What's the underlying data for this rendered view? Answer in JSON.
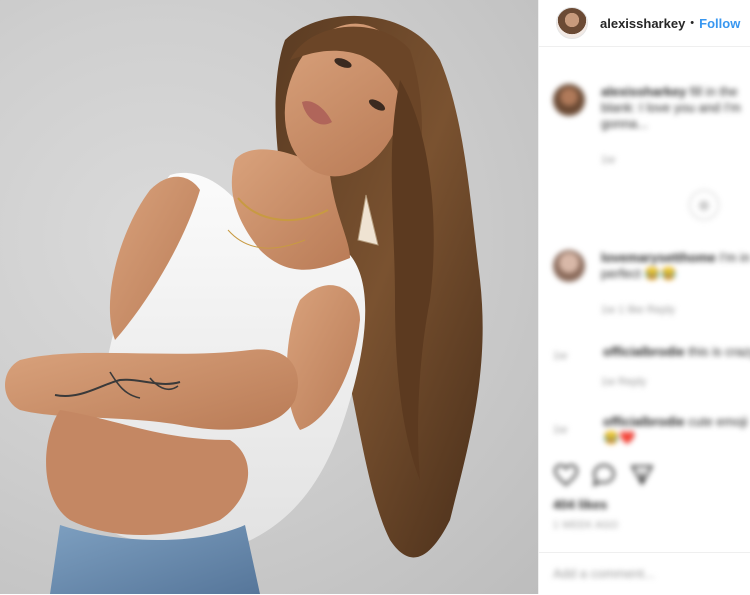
{
  "post": {
    "username": "alexissharkey",
    "separator": "•",
    "follow_label": "Follow"
  },
  "comments": [
    {
      "user": "alexissharkey",
      "text": "fill in the blank: I love you and I'm gonna...",
      "time": "1w"
    },
    {
      "user": "lovemarysetthome",
      "text": "I'm in perfect 😂😂",
      "meta": "1w  1 like  Reply"
    },
    {
      "user": "officialbrodie",
      "text": "this is crazy",
      "meta": "1w  Reply"
    },
    {
      "user": "officialbrodie",
      "text": "cute emoji 😂❤️",
      "meta": "1w"
    }
  ],
  "likes": "404 likes",
  "date": "1 WEEK AGO",
  "add_comment_placeholder": "Add a comment...",
  "icons": [
    "heart-icon",
    "comment-icon",
    "share-icon",
    "load-more-icon"
  ],
  "colors": {
    "link": "#3897f0",
    "text": "#262626",
    "muted": "#999999"
  }
}
